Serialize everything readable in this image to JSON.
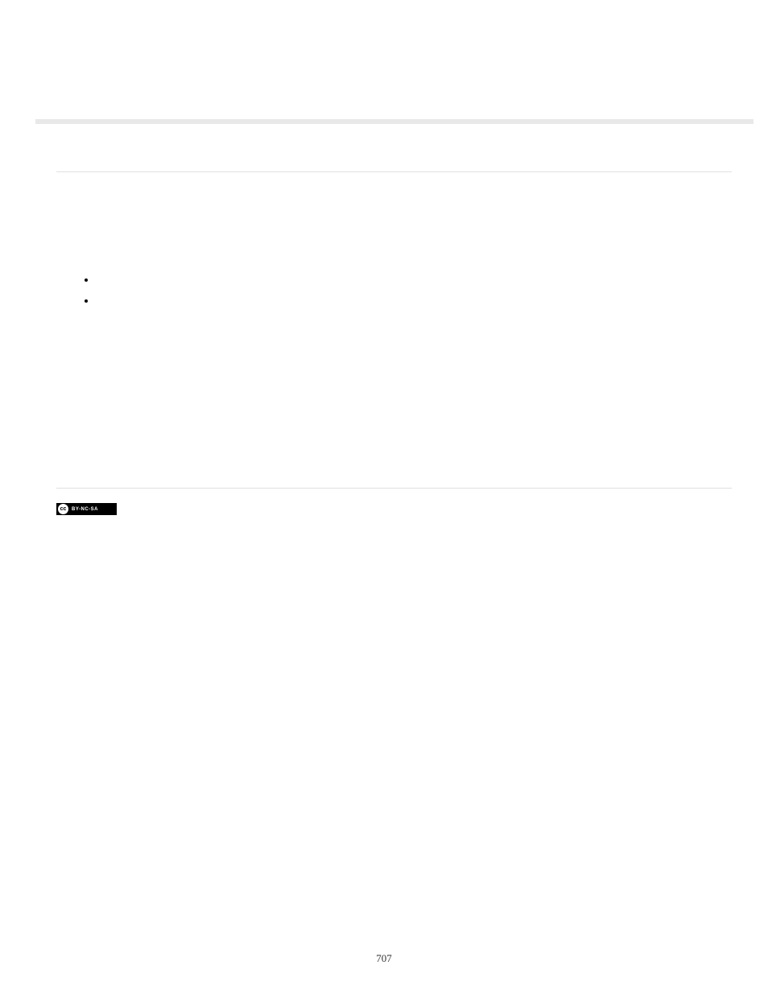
{
  "cc_badge": {
    "icon_text": "cc",
    "label": "BY-NC-SA"
  },
  "page_number": "707"
}
